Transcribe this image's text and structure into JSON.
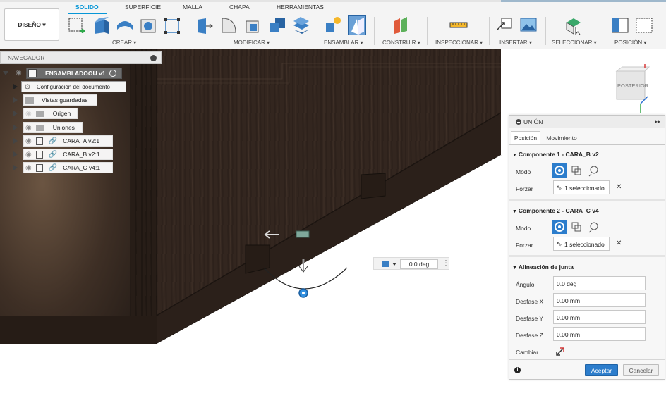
{
  "toolbar": {
    "design_button": "DISEÑO",
    "tabs": [
      "SOLIDO",
      "SUPERFICIE",
      "MALLA",
      "CHAPA",
      "HERRAMIENTAS"
    ],
    "groups": {
      "crear": "CREAR",
      "modificar": "MODIFICAR",
      "ensamblar": "ENSAMBLAR",
      "construir": "CONSTRUIR",
      "inspeccionar": "INSPECCIONAR",
      "insertar": "INSERTAR",
      "seleccionar": "SELECCIONAR",
      "posicion": "POSICIÓN"
    }
  },
  "navigator": {
    "title": "NAVEGADOR",
    "root": "ENSAMBLADOOU v1",
    "items": [
      "Configuración del documento",
      "Vistas guardadas",
      "Origen",
      "Uniones",
      "CARA_A v2:1",
      "CARA_B v2:1",
      "CARA_C v4:1"
    ]
  },
  "viewcube": {
    "label": "POSTERIOR"
  },
  "angle_widget": {
    "value": "0.0 deg"
  },
  "panel": {
    "title": "UNIÓN",
    "tabs": [
      "Posición",
      "Movimiento"
    ],
    "component1": {
      "title": "Componente 1 - CARA_B v2",
      "mode_label": "Modo",
      "force_label": "Forzar",
      "force_value": "1 seleccionado"
    },
    "component2": {
      "title": "Componente 2 - CARA_C v4",
      "mode_label": "Modo",
      "force_label": "Forzar",
      "force_value": "1 seleccionado"
    },
    "alignment": {
      "title": "Alineación de junta",
      "angle_label": "Ángulo",
      "angle_value": "0.0 deg",
      "dx_label": "Desfase X",
      "dx_value": "0.00 mm",
      "dy_label": "Desfase Y",
      "dy_value": "0.00 mm",
      "dz_label": "Desfase Z",
      "dz_value": "0.00 mm",
      "flip_label": "Cambiar"
    },
    "ok": "Aceptar",
    "cancel": "Cancelar"
  },
  "colors": {
    "accent": "#0696d7",
    "ok_button": "#2c7dcc",
    "wood_dark": "#2e221c"
  }
}
